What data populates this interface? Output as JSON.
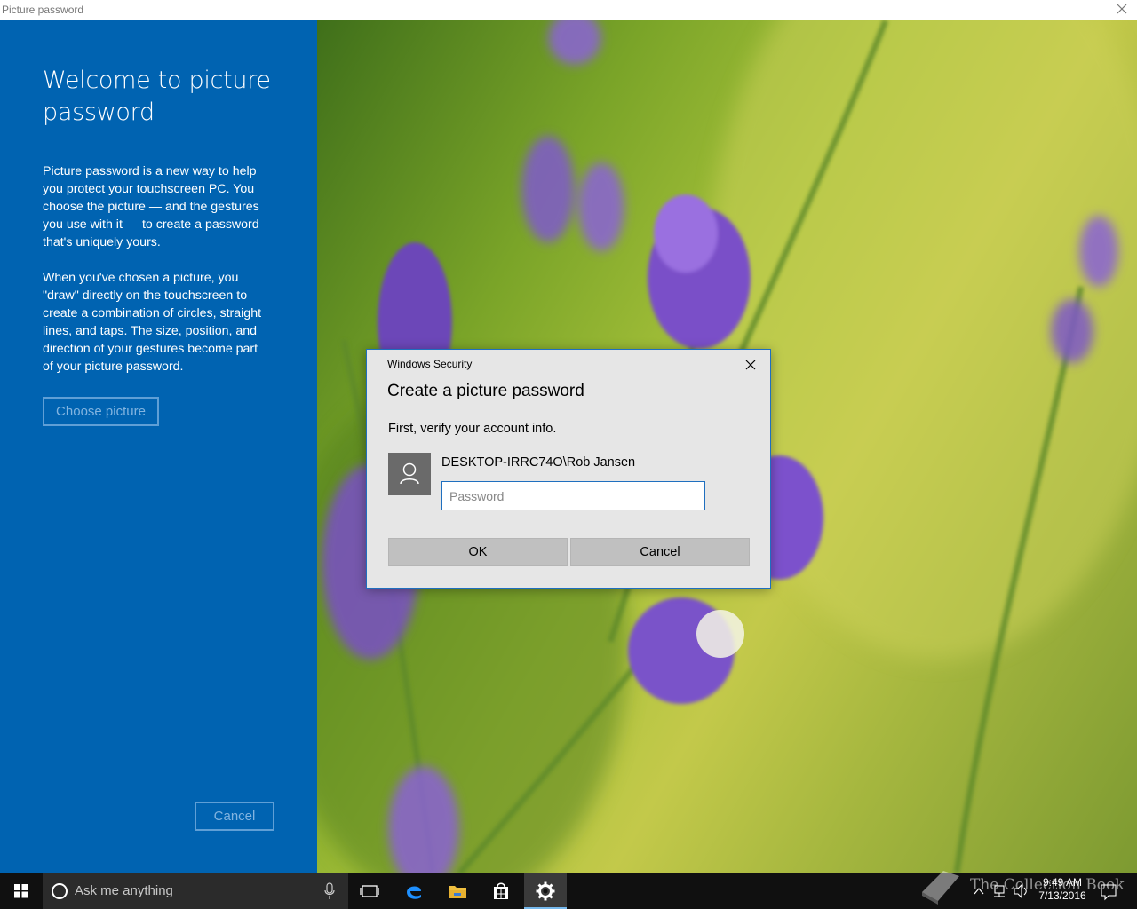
{
  "window": {
    "title": "Picture password"
  },
  "left_panel": {
    "heading": "Welcome to picture password",
    "paragraph1": "Picture password is a new way to help you protect your touchscreen PC. You choose the picture — and the gestures you use with it — to create a password that's uniquely yours.",
    "paragraph2": "When you've chosen a picture, you \"draw\" directly on the touchscreen to create a combination of circles, straight lines, and taps. The size, position, and direction of your gestures become part of your picture password.",
    "choose_button": "Choose picture",
    "cancel_button": "Cancel"
  },
  "dialog": {
    "title": "Windows Security",
    "heading": "Create a picture password",
    "subtitle": "First, verify your account info.",
    "account": "DESKTOP-IRRC74O\\Rob Jansen",
    "password_placeholder": "Password",
    "password_value": "",
    "ok_button": "OK",
    "cancel_button": "Cancel"
  },
  "taskbar": {
    "search_placeholder": "Ask me anything",
    "time": "9:49 AM",
    "date": "7/13/2016",
    "apps": [
      "task-view",
      "edge",
      "file-explorer",
      "store",
      "settings"
    ],
    "active_app": "settings"
  },
  "watermark": {
    "text": "The Collection Book"
  },
  "colors": {
    "panel_blue": "#0063b1",
    "taskbar": "#101010",
    "dialog_bg": "#e6e6e6",
    "accent": "#1f6fbf"
  }
}
